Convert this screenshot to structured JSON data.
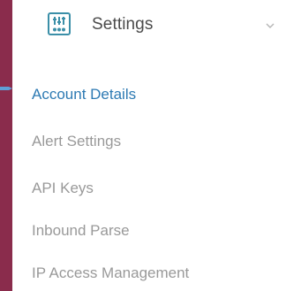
{
  "settings_menu": {
    "title": "Settings",
    "icon": "sliders-icon",
    "expanded": true,
    "items": [
      {
        "label": "Account Details",
        "active": true
      },
      {
        "label": "Alert Settings",
        "active": false
      },
      {
        "label": "API Keys",
        "active": false
      },
      {
        "label": "Inbound Parse",
        "active": false
      },
      {
        "label": "IP Access Management",
        "active": false
      }
    ]
  },
  "colors": {
    "background": "#8a2c4c",
    "panel": "#ffffff",
    "active_item": "#2d7ab3",
    "inactive_item": "#999999",
    "icon_accent": "#3b8fa8"
  }
}
